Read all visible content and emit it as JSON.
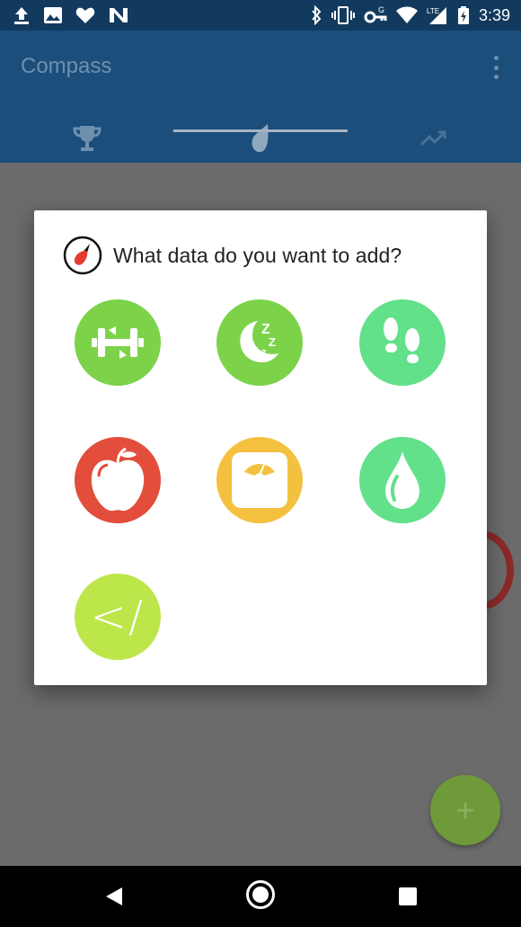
{
  "status_bar": {
    "time": "3:39",
    "left_icons": [
      "upload-icon",
      "image-icon",
      "heart-icon",
      "n-app-icon"
    ],
    "right_icons": [
      "bluetooth-icon",
      "vibrate-icon",
      "vpn-key-icon",
      "wifi-icon",
      "lte-signal-icon",
      "battery-charging-icon"
    ]
  },
  "app_bar": {
    "title": "Compass",
    "tabs": [
      {
        "icon": "trophy-icon"
      },
      {
        "icon": "compass-leaf-icon"
      },
      {
        "icon": "trending-up-icon"
      }
    ],
    "selected_tab": 1
  },
  "dialog": {
    "title": "What data do you want to add?",
    "options": [
      {
        "icon": "dumbbell-icon",
        "color": "#7cd34a"
      },
      {
        "icon": "sleep-moon-icon",
        "color": "#7cd34a"
      },
      {
        "icon": "footsteps-icon",
        "color": "#62e08a"
      },
      {
        "icon": "apple-icon",
        "color": "#e24d3c"
      },
      {
        "icon": "scale-icon",
        "color": "#f3c13f"
      },
      {
        "icon": "water-drop-icon",
        "color": "#62e08a"
      },
      {
        "icon": "code-icon",
        "color": "#bde64a",
        "label": "</"
      }
    ]
  },
  "fab": {
    "label": "+"
  },
  "colors": {
    "status_bar": "#123a5e",
    "app_bar": "#1c4e7c",
    "scrim": "#6b6b6b",
    "fab": "#6f9a3a"
  }
}
